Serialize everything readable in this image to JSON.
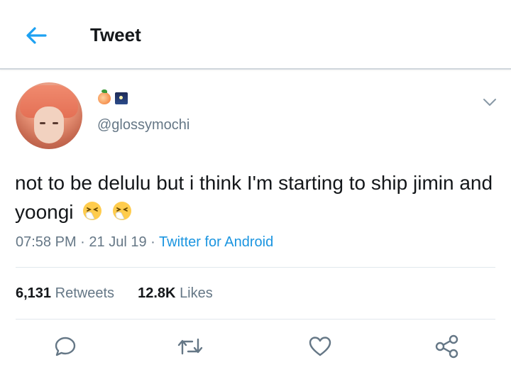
{
  "header": {
    "title": "Tweet",
    "back_icon": "arrow-left-icon",
    "accent_color": "#1da1f2"
  },
  "author": {
    "handle": "@glossymochi",
    "name_emojis": [
      "peach-emoji",
      "night-sky-emoji"
    ]
  },
  "tweet": {
    "text": "not to be delulu but i think I'm starting to ship jimin and yoongi",
    "trailing_emojis": [
      "sneezing-face-emoji",
      "sneezing-face-emoji"
    ],
    "time": "07:58 PM",
    "date": "21 Jul 19",
    "separator": "·",
    "source": "Twitter for Android"
  },
  "stats": {
    "retweets_count": "6,131",
    "retweets_label": "Retweets",
    "likes_count": "12.8K",
    "likes_label": "Likes"
  },
  "actions": [
    "reply-icon",
    "retweet-icon",
    "like-icon",
    "share-icon"
  ],
  "colors": {
    "link": "#1b95e0",
    "secondary_text": "#657786",
    "primary_text": "#14171a"
  }
}
